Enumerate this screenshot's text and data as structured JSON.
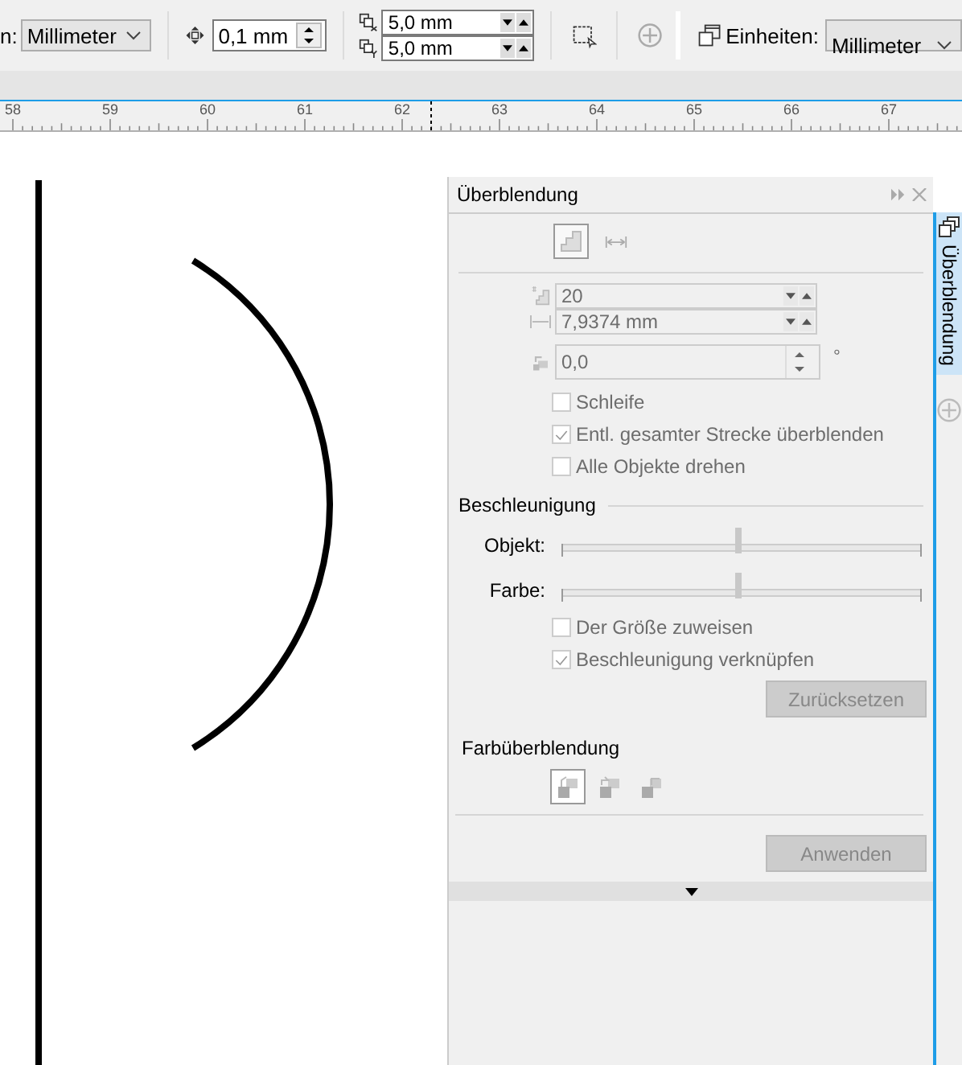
{
  "toolbar": {
    "units_cut": {
      "label": "n:",
      "value": "Millimeter"
    },
    "nudge": "0,1 mm",
    "duplicate_x": "5,0 mm",
    "duplicate_y": "5,0 mm",
    "add_button": {
      "disabled": true
    },
    "units": {
      "label": "Einheiten:",
      "value": "Millimeter"
    }
  },
  "ruler": {
    "labels": [
      "58",
      "59",
      "60",
      "61",
      "62",
      "63",
      "64",
      "65",
      "66",
      "67"
    ]
  },
  "panel": {
    "title": "Überblendung",
    "steps": "20",
    "spacing": "7,9374 mm",
    "rotation": "0,0",
    "degree": "°",
    "options": [
      {
        "label": "Schleife",
        "checked": false,
        "disabled": true
      },
      {
        "label": "Entl. gesamter Strecke überblenden",
        "checked": true,
        "disabled": true
      },
      {
        "label": "Alle Objekte drehen",
        "checked": false,
        "disabled": true
      }
    ],
    "acceleration": {
      "title": "Beschleunigung",
      "sliders": [
        {
          "label": "Objekt:",
          "level": 0.49
        },
        {
          "label": "Farbe:",
          "level": 0.49
        }
      ],
      "options": [
        {
          "label": "Der Größe zuweisen",
          "checked": false,
          "disabled": true
        },
        {
          "label": "Beschleunigung verknüpfen",
          "checked": true,
          "disabled": true
        }
      ],
      "reset": {
        "label": "Zurücksetzen",
        "disabled": true
      }
    },
    "color_blend": {
      "title": "Farbüberblendung",
      "modes": [
        {
          "selected": true
        },
        {
          "selected": false
        },
        {
          "selected": false
        }
      ]
    },
    "apply": {
      "label": "Anwenden",
      "disabled": true
    }
  },
  "docker_tab": {
    "label": "Überblendung",
    "selected": true
  }
}
